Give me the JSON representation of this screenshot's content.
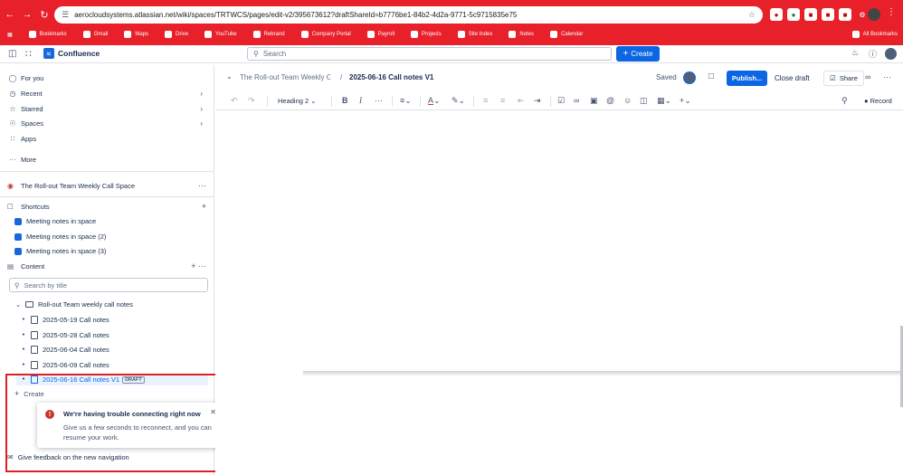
{
  "browser": {
    "url": "aerocloudsystems.atlassian.net/wiki/spaces/TRTWCS/pages/edit-v2/395673612?draftShareId=b7776be1-84b2-4d2a-9771-5c9715835e75",
    "bookmarks": [
      "Bookmarks",
      "Gmail",
      "Maps",
      "Drive",
      "YouTube",
      "Rebrand",
      "Company Portal",
      "Payroll",
      "Projects",
      "Site Index",
      "Notes",
      "Calendar"
    ],
    "bookmarks_right": "All Bookmarks"
  },
  "app": {
    "product_name": "Confluence",
    "search_placeholder": "Search",
    "create_label": "Create"
  },
  "sidebar": {
    "nav": [
      {
        "label": "For you",
        "icon": "home-icon"
      },
      {
        "label": "Recent",
        "icon": "clock-icon"
      },
      {
        "label": "Starred",
        "icon": "star-icon"
      },
      {
        "label": "Spaces",
        "icon": "globe-icon"
      },
      {
        "label": "Apps",
        "icon": "apps-icon"
      }
    ],
    "more_label": "More",
    "space_name": "The Roll-out Team Weekly Call Space",
    "shortcuts_label": "Shortcuts",
    "shortcuts": [
      "Meeting notes in space",
      "Meeting notes in space (2)",
      "Meeting notes in space (3)"
    ],
    "content_label": "Content",
    "search_placeholder": "Search by title",
    "folder_label": "Roll-out Team weekly call notes",
    "pages": [
      "2025-05-19 Call notes",
      "2025-05-28 Call notes",
      "2025-06-04 Call notes",
      "2025-06-09 Call notes"
    ],
    "active_page": "2025-06-16 Call notes V1",
    "draft_badge": "DRAFT",
    "create_label": "Create",
    "feedback_label": "Give feedback on the new navigation"
  },
  "toast": {
    "title": "We're having trouble connecting right now",
    "body": "Give us a few seconds to reconnect, and you can resume your work."
  },
  "editor": {
    "space_breadcrumb": "The Roll-out Team Weekly Ca...",
    "page_title": "2025-06-16 Call notes V1",
    "saved_label": "Saved",
    "publish_label": "Publish...",
    "close_draft_label": "Close draft",
    "share_label": "Share",
    "heading_select": "Heading 2",
    "record_label": "Record"
  }
}
